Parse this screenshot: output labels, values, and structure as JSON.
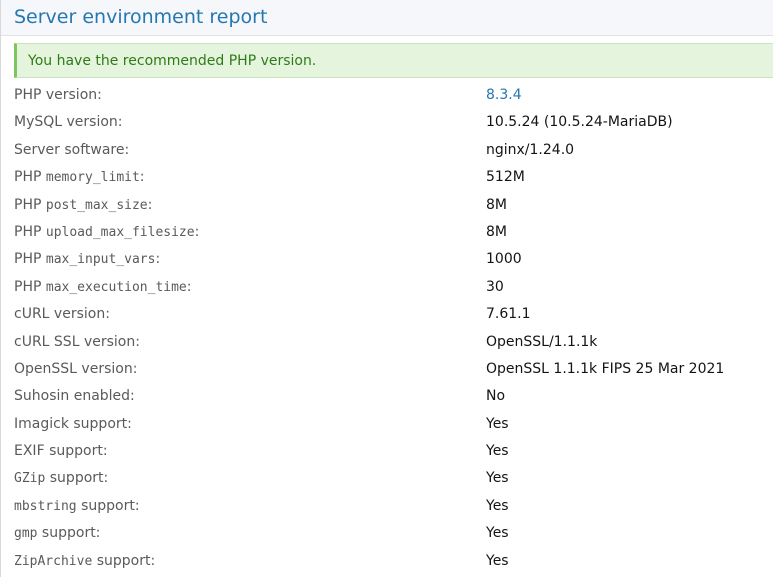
{
  "panel": {
    "title": "Server environment report"
  },
  "alert": {
    "message": "You have the recommended PHP version."
  },
  "rows": [
    {
      "prefix": "PHP version:",
      "code": "",
      "suffix": "",
      "value": "8.3.4",
      "value_is_link": true
    },
    {
      "prefix": "MySQL version:",
      "code": "",
      "suffix": "",
      "value": "10.5.24 (10.5.24-MariaDB)",
      "value_is_link": false
    },
    {
      "prefix": "Server software:",
      "code": "",
      "suffix": "",
      "value": "nginx/1.24.0",
      "value_is_link": false
    },
    {
      "prefix": "PHP ",
      "code": "memory_limit",
      "suffix": ":",
      "value": "512M",
      "value_is_link": false
    },
    {
      "prefix": "PHP ",
      "code": "post_max_size",
      "suffix": ":",
      "value": "8M",
      "value_is_link": false
    },
    {
      "prefix": "PHP ",
      "code": "upload_max_filesize",
      "suffix": ":",
      "value": "8M",
      "value_is_link": false
    },
    {
      "prefix": "PHP ",
      "code": "max_input_vars",
      "suffix": ":",
      "value": "1000",
      "value_is_link": false
    },
    {
      "prefix": "PHP ",
      "code": "max_execution_time",
      "suffix": ":",
      "value": "30",
      "value_is_link": false
    },
    {
      "prefix": "cURL version:",
      "code": "",
      "suffix": "",
      "value": "7.61.1",
      "value_is_link": false
    },
    {
      "prefix": "cURL SSL version:",
      "code": "",
      "suffix": "",
      "value": "OpenSSL/1.1.1k",
      "value_is_link": false
    },
    {
      "prefix": "OpenSSL version:",
      "code": "",
      "suffix": "",
      "value": "OpenSSL 1.1.1k FIPS 25 Mar 2021",
      "value_is_link": false
    },
    {
      "prefix": "Suhosin enabled:",
      "code": "",
      "suffix": "",
      "value": "No",
      "value_is_link": false
    },
    {
      "prefix": "Imagick support:",
      "code": "",
      "suffix": "",
      "value": "Yes",
      "value_is_link": false
    },
    {
      "prefix": "EXIF support:",
      "code": "",
      "suffix": "",
      "value": "Yes",
      "value_is_link": false
    },
    {
      "prefix": "",
      "code": "GZip",
      "suffix": " support:",
      "value": "Yes",
      "value_is_link": false
    },
    {
      "prefix": "",
      "code": "mbstring",
      "suffix": " support:",
      "value": "Yes",
      "value_is_link": false
    },
    {
      "prefix": "",
      "code": "gmp",
      "suffix": " support:",
      "value": "Yes",
      "value_is_link": false
    },
    {
      "prefix": "",
      "code": "ZipArchive",
      "suffix": " support:",
      "value": "Yes",
      "value_is_link": false
    }
  ],
  "colors": {
    "title": "#2577b1",
    "link": "#2577b1",
    "alert_bg": "#e5f5dd",
    "alert_text": "#2f7a18",
    "alert_accent": "#7ec45f",
    "label": "#5a5a5a",
    "value": "#141414"
  }
}
